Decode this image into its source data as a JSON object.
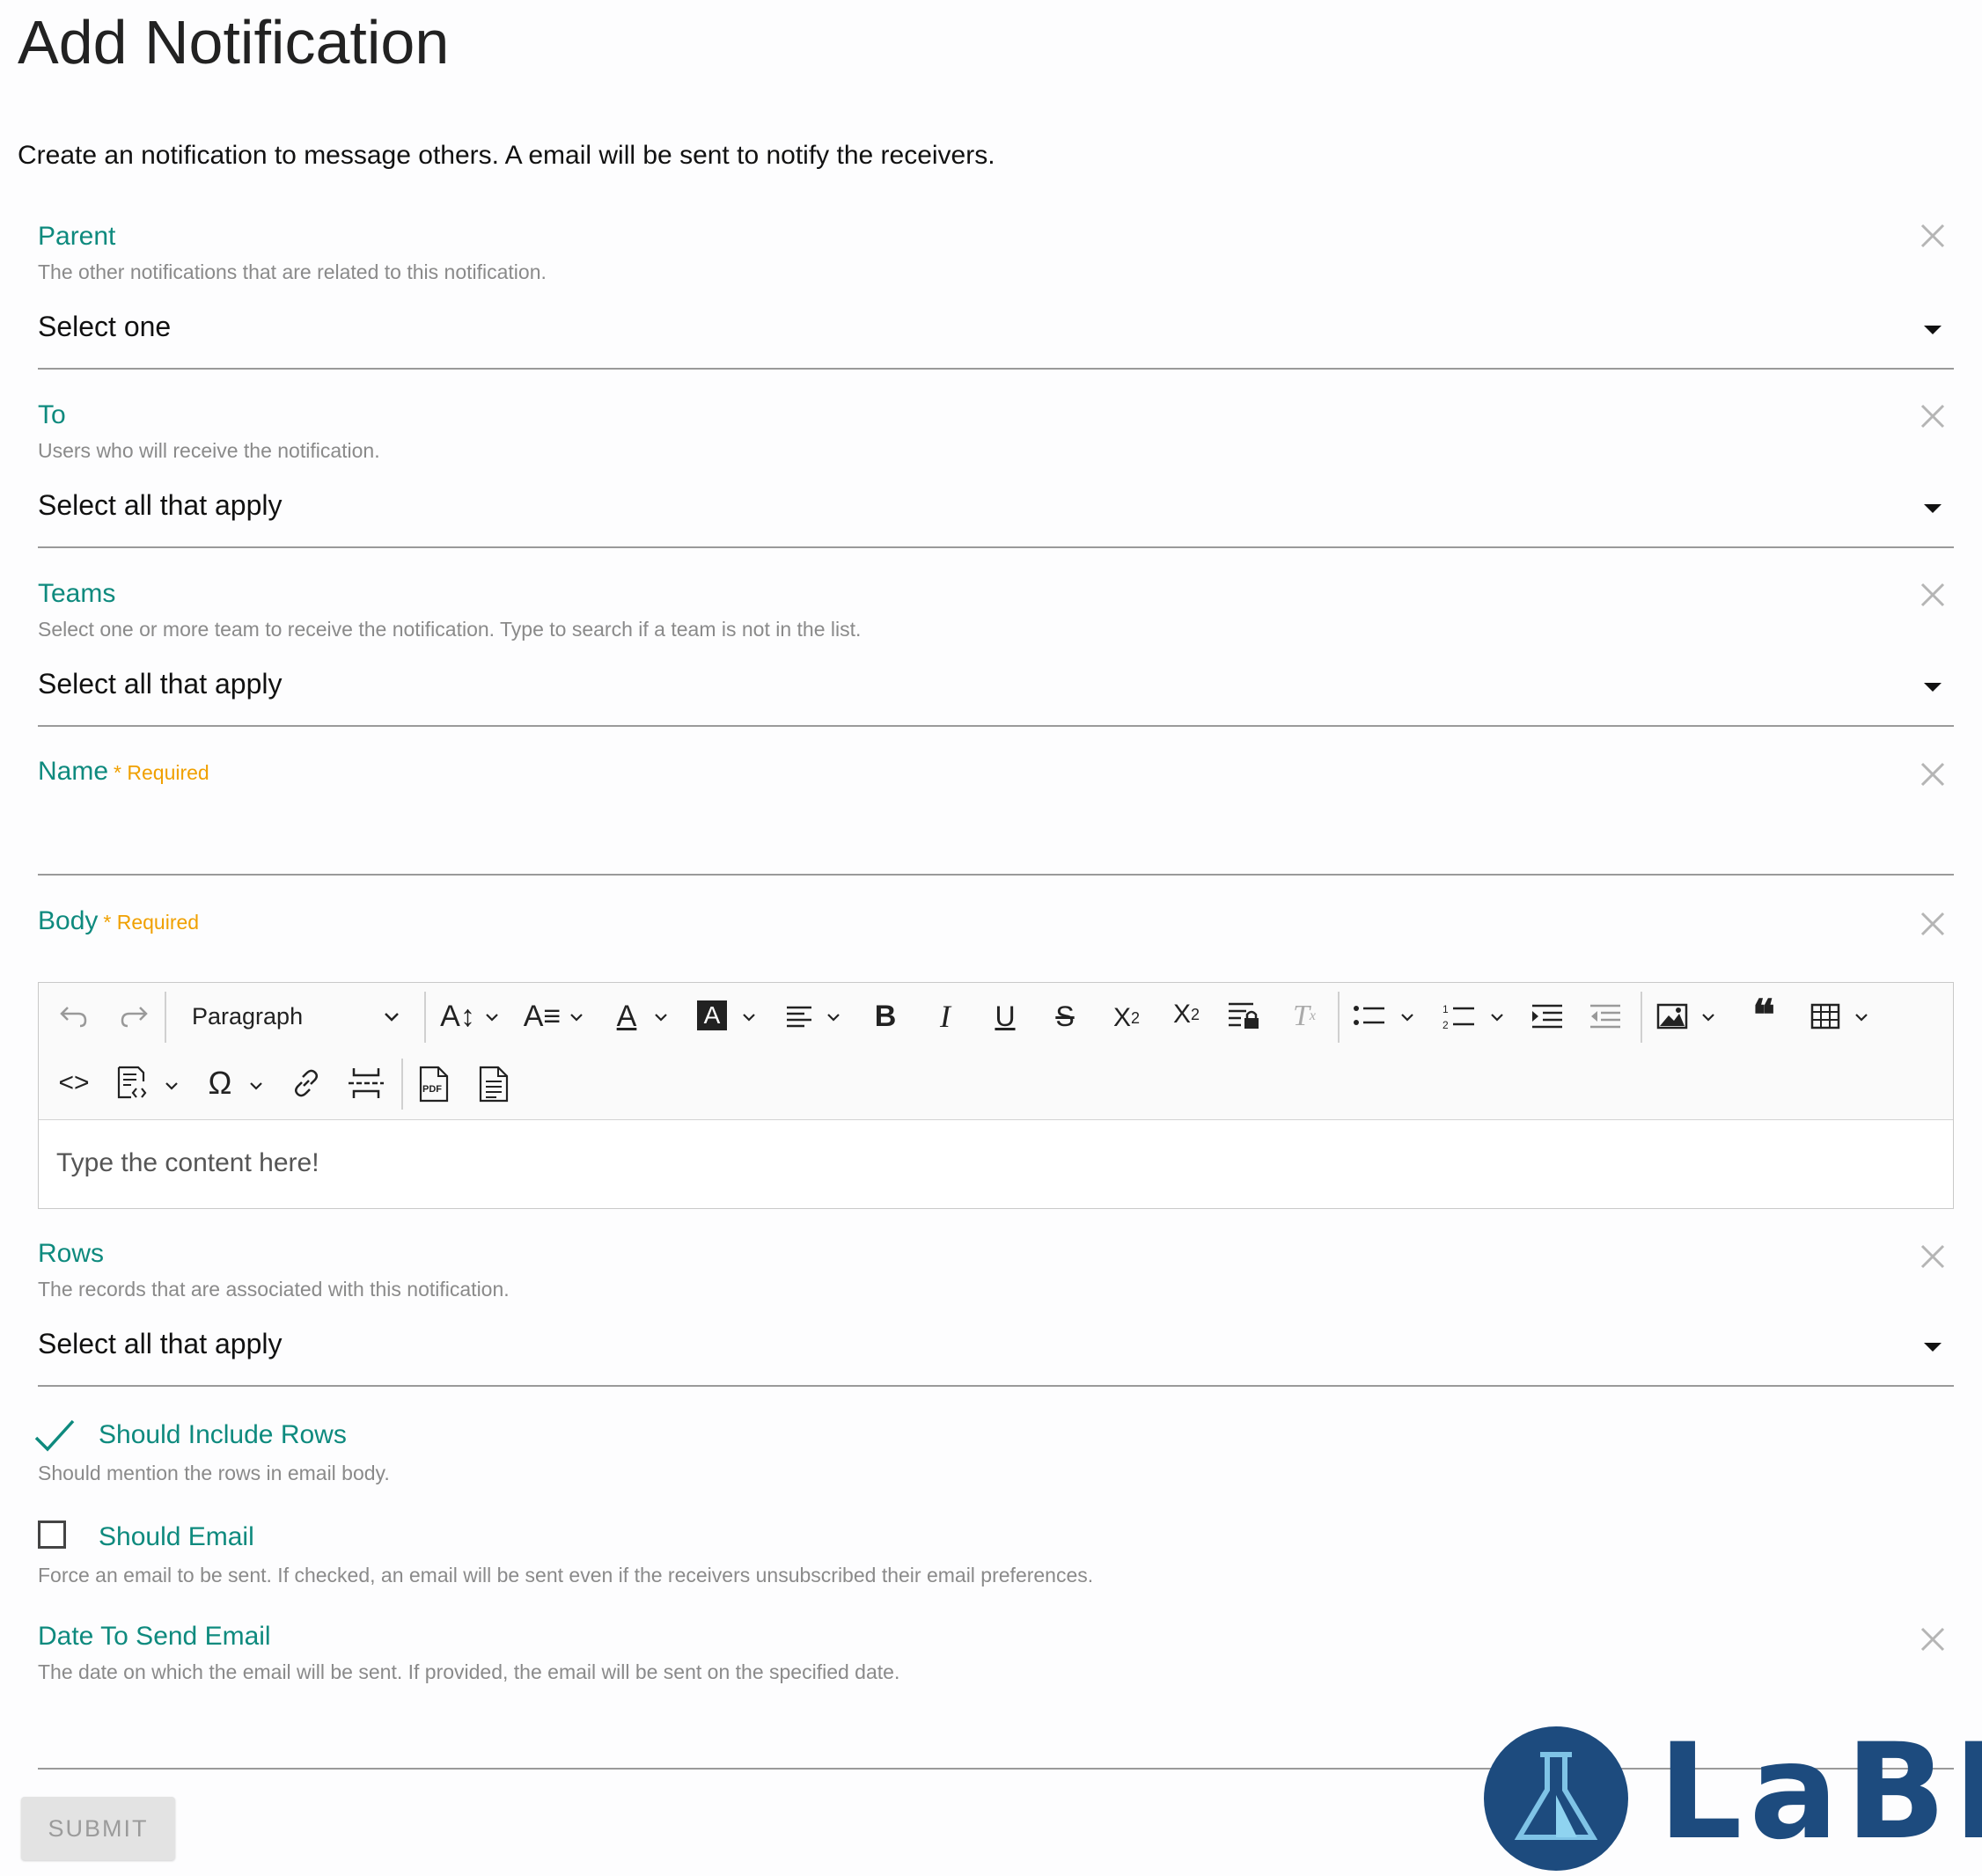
{
  "page": {
    "title": "Add Notification",
    "intro": "Create an notification to message others. A email will be sent to notify the receivers."
  },
  "fields": {
    "parent": {
      "label": "Parent",
      "description": "The other notifications that are related to this notification.",
      "value": "Select one"
    },
    "to": {
      "label": "To",
      "description": "Users who will receive the notification.",
      "value": "Select all that apply"
    },
    "teams": {
      "label": "Teams",
      "description": "Select one or more team to receive the notification. Type to search if a team is not in the list.",
      "value": "Select all that apply"
    },
    "name": {
      "label": "Name",
      "required": "* Required",
      "value": ""
    },
    "body": {
      "label": "Body",
      "required": "* Required",
      "paragraph_select": "Paragraph",
      "placeholder": "Type the content here!"
    },
    "rows": {
      "label": "Rows",
      "description": "The records that are associated with this notification.",
      "value": "Select all that apply"
    },
    "should_include_rows": {
      "label": "Should Include Rows",
      "description": "Should mention the rows in email body.",
      "checked": true
    },
    "should_email": {
      "label": "Should Email",
      "description": "Force an email to be sent. If checked, an email will be sent even if the receivers unsubscribed their email preferences.",
      "checked": false
    },
    "date_to_send": {
      "label": "Date To Send Email",
      "description": "The date on which the email will be sent. If provided, the email will be sent on the specified date.",
      "value": ""
    }
  },
  "toolbar_icons": [
    "undo-icon",
    "redo-icon",
    "font-size-icon",
    "font-family-icon",
    "font-color-icon",
    "font-background-color-icon",
    "align-icon",
    "bold-icon",
    "italic-icon",
    "underline-icon",
    "strikethrough-icon",
    "subscript-icon",
    "superscript-icon",
    "restricted-editing-icon",
    "remove-format-icon",
    "bulleted-list-icon",
    "numbered-list-icon",
    "indent-icon",
    "outdent-icon",
    "insert-image-icon",
    "block-quote-icon",
    "insert-table-icon",
    "source-code-icon",
    "html-embed-icon",
    "special-characters-icon",
    "link-icon",
    "page-break-icon",
    "export-pdf-icon",
    "document-icon"
  ],
  "submit": {
    "label": "SUBMIT"
  },
  "logo": {
    "text": "LaBII"
  },
  "colors": {
    "label": "#0e8a7e",
    "required": "#f0a000",
    "description": "#8a8a8a",
    "logo": "#1d4b7e"
  }
}
